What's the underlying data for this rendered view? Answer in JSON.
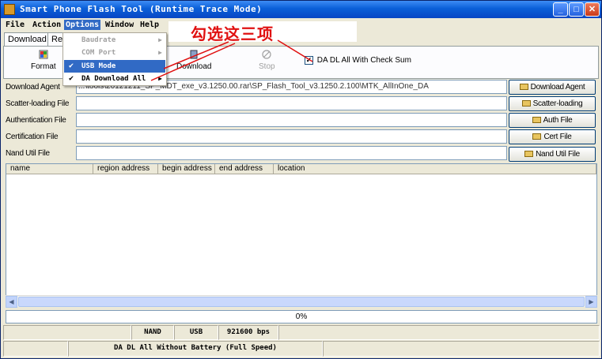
{
  "window": {
    "title": "Smart Phone Flash Tool (Runtime Trace Mode)",
    "controls": {
      "minimize": "_",
      "maximize": "□",
      "close": "✕"
    }
  },
  "menubar": {
    "file": "File",
    "action": "Action",
    "options": "Options",
    "window": "Window",
    "help": "Help"
  },
  "tabs": {
    "download": "Download",
    "readback": "Re"
  },
  "toolbar": {
    "format": "Format",
    "download": "Download",
    "stop": "Stop"
  },
  "options_menu": {
    "baudrate": "Baudrate",
    "com_port": "COM Port",
    "usb_mode": "USB Mode",
    "da_download_all": "DA Download All"
  },
  "annotation": "勾选这三项",
  "checksum": {
    "label": "DA DL All With Check Sum",
    "checked": true
  },
  "files": {
    "download_agent": {
      "label": "Download Agent",
      "value": "...\\tools\\20121211_SP_MDT_exe_v3.1250.00.rar\\SP_Flash_Tool_v3.1250.2.100\\MTK_AllInOne_DA",
      "button": "Download Agent"
    },
    "scatter": {
      "label": "Scatter-loading File",
      "value": "",
      "button": "Scatter-loading"
    },
    "auth": {
      "label": "Authentication File",
      "value": "",
      "button": "Auth File"
    },
    "cert": {
      "label": "Certification File",
      "value": "",
      "button": "Cert File"
    },
    "nand": {
      "label": "Nand Util File",
      "value": "",
      "button": "Nand Util File"
    }
  },
  "table": {
    "columns": [
      "name",
      "region address",
      "begin address",
      "end address",
      "location"
    ]
  },
  "progress": {
    "text": "0%"
  },
  "status": {
    "nand": "NAND",
    "usb": "USB",
    "baud": "921600 bps",
    "mode": "DA DL All Without Battery (Full Speed)"
  },
  "colors": {
    "titlebar": "#0a5fd8",
    "highlight": "#316ac5",
    "annotation": "#e01010"
  }
}
